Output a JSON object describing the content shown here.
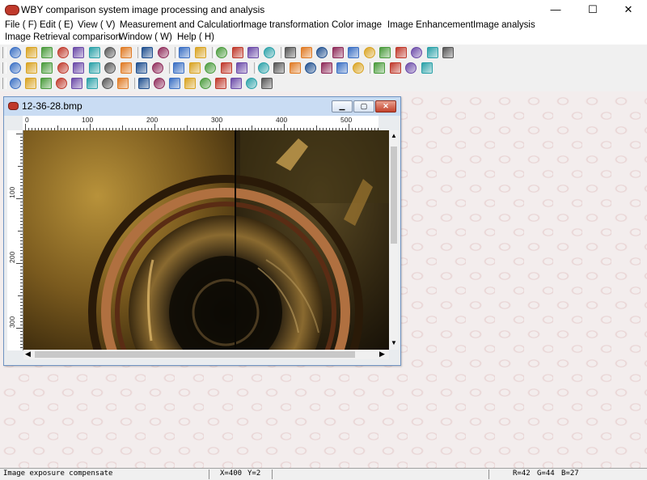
{
  "window": {
    "title": "WBY comparison system image processing and analysis",
    "minimize": "—",
    "maximize": "☐",
    "close": "✕"
  },
  "menu": {
    "row1": [
      "File ( F)",
      "Edit ( E)",
      "View ( V)",
      "Measurement and Calculation",
      "Image transformation",
      "Color image",
      "Image Enhancement",
      "Image analysis"
    ],
    "row2": [
      "Image Retrieval comparison",
      "Window ( W)",
      "Help ( H)"
    ]
  },
  "child_window": {
    "title": "12-36-28.bmp",
    "ruler_h_labels": [
      "0",
      "100",
      "200",
      "300",
      "400",
      "500"
    ],
    "ruler_v_labels": [
      "100",
      "200",
      "300"
    ]
  },
  "status": {
    "message": "Image exposure compensate",
    "x": "X=400",
    "y": "Y=2",
    "r": "R=42",
    "g": "G=44",
    "b": "B=27"
  },
  "colors": {
    "accent_red": "#c0392b",
    "mdi_background": "#f3eded",
    "child_titlebar": "#c9dcf3"
  },
  "icons": {
    "toolbar1": [
      "new-icon",
      "open-icon",
      "sync-icon",
      "folder-icon",
      "scan-icon",
      "camera-icon",
      "print-icon",
      "save-icon",
      "zoom-icon",
      "dropdown-icon",
      "undo-icon",
      "redo-icon",
      "cut-icon",
      "copy-icon",
      "paste-icon",
      "delete-icon",
      "tools-icon",
      "grid-icon",
      "layers-icon",
      "hist-icon",
      "colors-icon",
      "contour-icon",
      "triangle-icon",
      "select-icon",
      "circle-icon",
      "palette-icon",
      "image-icon"
    ],
    "toolbar2": [
      "gradient-icon",
      "bulb-icon",
      "brightness-icon",
      "yellow-icon",
      "matrix-icon",
      "dark-icon",
      "bar-icon",
      "sparkle-icon",
      "moon-icon",
      "chart-icon",
      "drop-icon",
      "blank-icon",
      "graph-icon",
      "wave-icon",
      "target-icon",
      "stack-icon",
      "flip-icon",
      "diamond-icon",
      "eye-icon",
      "window-icon",
      "record-icon",
      "cascade-icon",
      "tile-icon",
      "arrange-icon",
      "question-icon",
      "pointer-help-icon"
    ],
    "toolbar3": [
      "arrow-icon",
      "lasso-icon",
      "rect-select-icon",
      "ellipse-select-icon",
      "poly-select-icon",
      "free-select-icon",
      "magic-wand-icon",
      "move-icon",
      "line-icon",
      "pencil-icon",
      "rectangle-icon",
      "ellipse-icon",
      "polygon-icon",
      "heart-icon",
      "text-icon",
      "measure-icon",
      "angle-icon"
    ]
  }
}
